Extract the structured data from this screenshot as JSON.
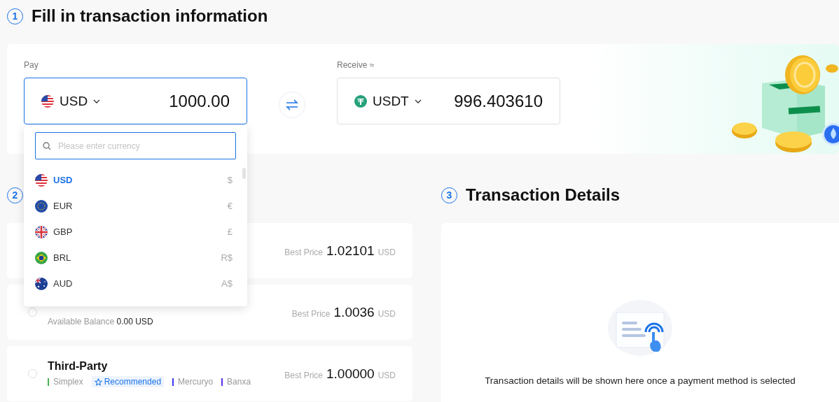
{
  "sections": [
    {
      "number": "1",
      "title": "Fill in transaction information"
    },
    {
      "number": "2"
    },
    {
      "number": "3",
      "title": "Transaction Details"
    }
  ],
  "pay": {
    "label": "Pay",
    "currency": "USD",
    "amount": "1000.00",
    "focused": true
  },
  "receive": {
    "label": "Receive ≈",
    "currency": "USDT",
    "amount": "996.403610",
    "focused": false
  },
  "currency_dropdown": {
    "search_placeholder": "Please enter currency",
    "options": [
      {
        "code": "USD",
        "symbol": "$",
        "selected": true
      },
      {
        "code": "EUR",
        "symbol": "€",
        "selected": false
      },
      {
        "code": "GBP",
        "symbol": "£",
        "selected": false
      },
      {
        "code": "BRL",
        "symbol": "R$",
        "selected": false
      },
      {
        "code": "AUD",
        "symbol": "A$",
        "selected": false
      }
    ]
  },
  "payment_methods": [
    {
      "price_label": "Best Price",
      "price": "1.02101",
      "price_unit": "USD"
    },
    {
      "note": "Available Balance",
      "balance": "0.00 USD",
      "selected": false,
      "price_label": "Best Price",
      "price": "1.0036",
      "price_unit": "USD"
    },
    {
      "title": "Third-Party",
      "selected": false,
      "providers": [
        {
          "kind": "provider",
          "name": "Simplex",
          "color": "#4caf50"
        },
        {
          "kind": "badge",
          "name": "Recommended"
        },
        {
          "kind": "provider",
          "name": "Mercuryo",
          "color": "#3b3bf0"
        },
        {
          "kind": "provider",
          "name": "Banxa",
          "color": "#5b2be6"
        }
      ],
      "price_label": "Best Price",
      "price": "1.00000",
      "price_unit": "USD"
    }
  ],
  "details": {
    "empty_message": "Transaction details will be shown here once a payment method is selected"
  }
}
